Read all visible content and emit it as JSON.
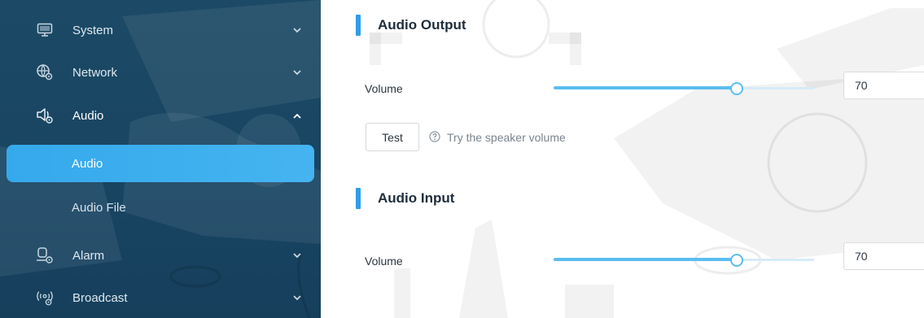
{
  "sidebar": {
    "items": [
      {
        "label": "System",
        "icon": "monitor-icon",
        "expanded": false
      },
      {
        "label": "Network",
        "icon": "globe-gear-icon",
        "expanded": false
      },
      {
        "label": "Audio",
        "icon": "speaker-gear-icon",
        "expanded": true,
        "children": [
          {
            "label": "Audio",
            "active": true
          },
          {
            "label": "Audio File",
            "active": false
          }
        ]
      },
      {
        "label": "Alarm",
        "icon": "alarm-gear-icon",
        "expanded": false
      },
      {
        "label": "Broadcast",
        "icon": "broadcast-gear-icon",
        "expanded": false
      }
    ]
  },
  "main": {
    "audio_output": {
      "title": "Audio Output",
      "volume_label": "Volume",
      "volume_value": "70",
      "slider_fraction": 0.7,
      "test_button": "Test",
      "hint": "Try the speaker volume"
    },
    "audio_input": {
      "title": "Audio Input",
      "volume_label": "Volume",
      "volume_value": "70",
      "slider_fraction": 0.7
    }
  },
  "colors": {
    "sidebar_bg": "#1c4a66",
    "active_item": "#35a9ec",
    "accent": "#2f9ee8",
    "slider": "#5bbdf0"
  }
}
